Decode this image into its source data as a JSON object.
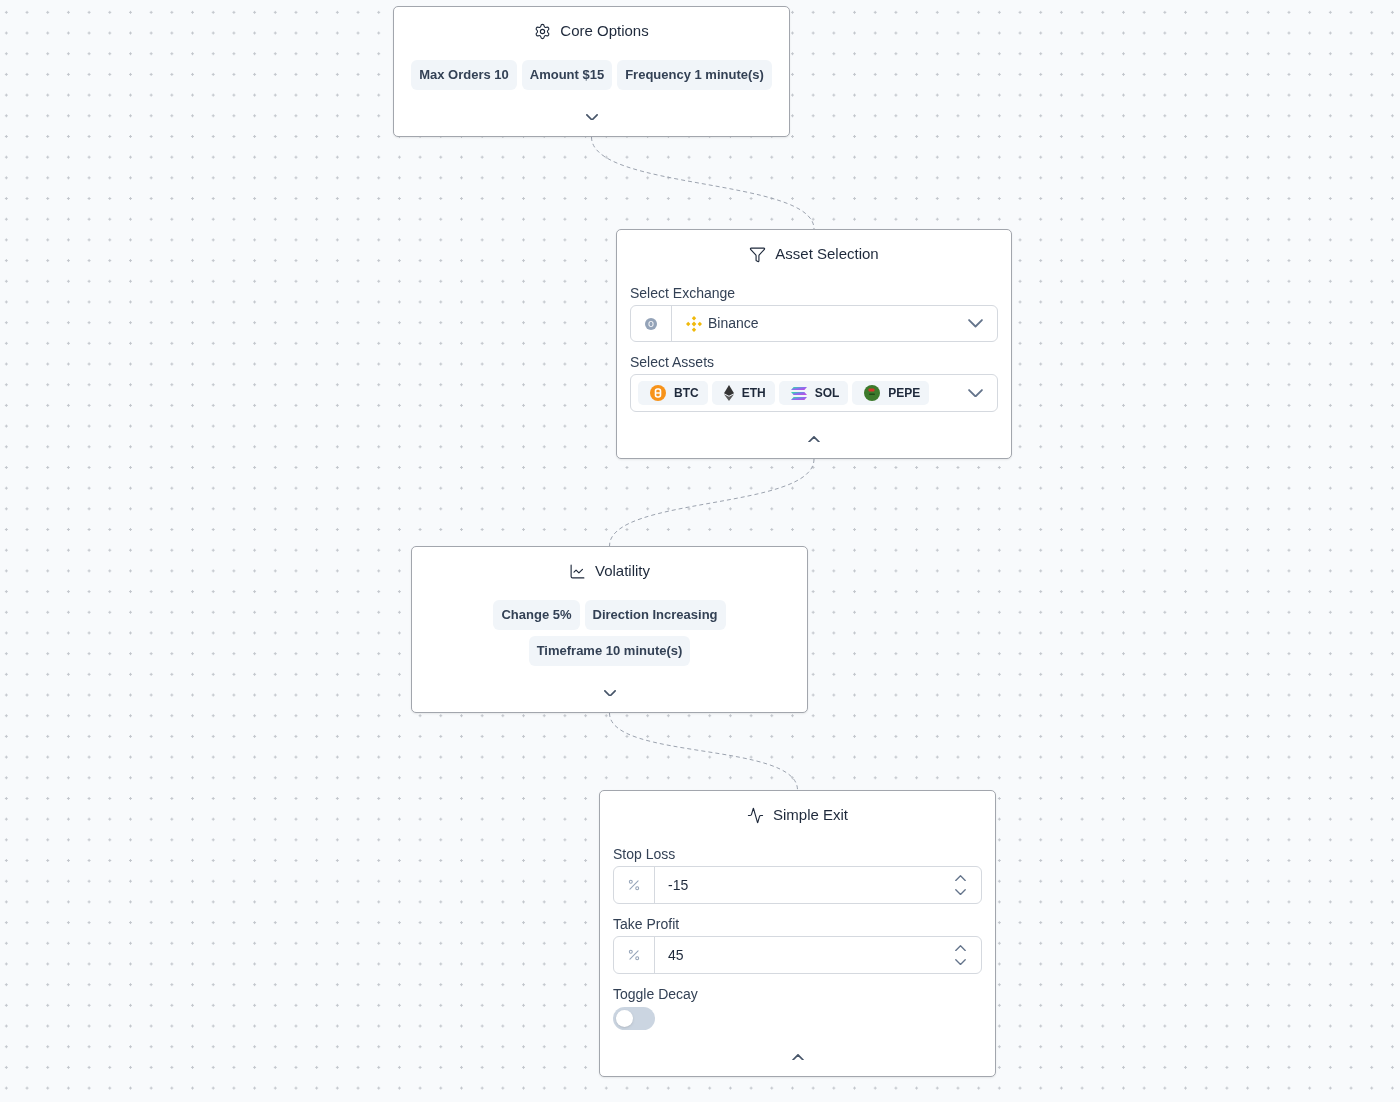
{
  "canvas": {
    "nodes": [
      {
        "title": "Core Options",
        "expanded": false,
        "tags": [
          "Max Orders 10",
          "Amount $15",
          "Frequency 1 minute(s)"
        ]
      },
      {
        "title": "Asset Selection",
        "expanded": true,
        "fields": [
          {
            "kind": "select",
            "label": "Select Exchange",
            "value": "Binance"
          },
          {
            "kind": "multiselect",
            "label": "Select Assets",
            "chips": [
              "BTC",
              "ETH",
              "SOL",
              "PEPE"
            ]
          }
        ]
      },
      {
        "title": "Volatility",
        "expanded": false,
        "tags": [
          "Change 5%",
          "Direction Increasing",
          "Timeframe 10 minute(s)"
        ]
      },
      {
        "title": "Simple Exit",
        "expanded": true,
        "fields": [
          {
            "kind": "number",
            "label": "Stop Loss",
            "value": "-15"
          },
          {
            "kind": "number",
            "label": "Take Profit",
            "value": "45"
          },
          {
            "kind": "toggle",
            "label": "Toggle Decay",
            "on": false
          }
        ]
      }
    ]
  }
}
